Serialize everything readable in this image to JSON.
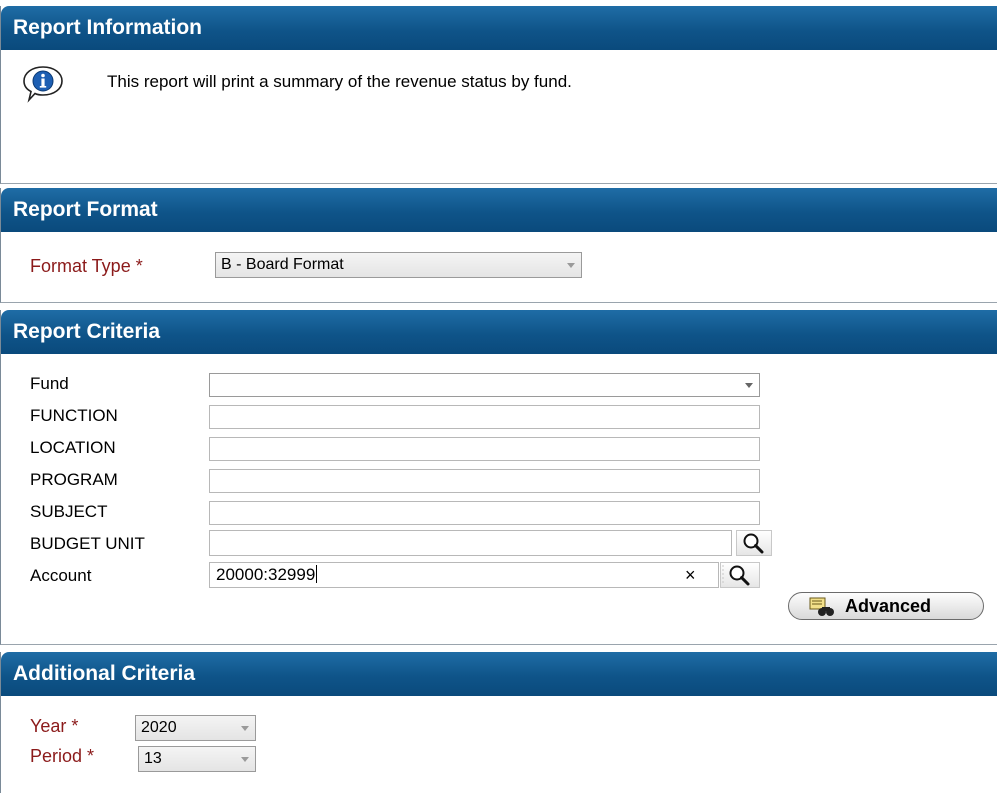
{
  "report_information": {
    "title": "Report Information",
    "message": "This report will print a summary of the revenue status by fund.",
    "icon": "info-icon"
  },
  "report_format": {
    "title": "Report Format",
    "format_type_label": "Format Type",
    "required_marker": "*",
    "format_type_value": "B - Board Format"
  },
  "report_criteria": {
    "title": "Report Criteria",
    "fields": [
      {
        "label": "Fund",
        "value": ""
      },
      {
        "label": "FUNCTION",
        "value": ""
      },
      {
        "label": "LOCATION",
        "value": ""
      },
      {
        "label": "PROGRAM",
        "value": ""
      },
      {
        "label": "SUBJECT",
        "value": ""
      },
      {
        "label": "BUDGET UNIT",
        "value": ""
      },
      {
        "label": "Account",
        "value": "20000:32999"
      }
    ],
    "clear_symbol": "×",
    "advanced_label": "Advanced"
  },
  "additional_criteria": {
    "title": "Additional Criteria",
    "year_label": "Year",
    "year_value": "2020",
    "period_label": "Period",
    "period_value": "13",
    "required_marker": "*"
  },
  "colors": {
    "header_blue": "#0f5489",
    "required_red": "#8b1a1a"
  }
}
